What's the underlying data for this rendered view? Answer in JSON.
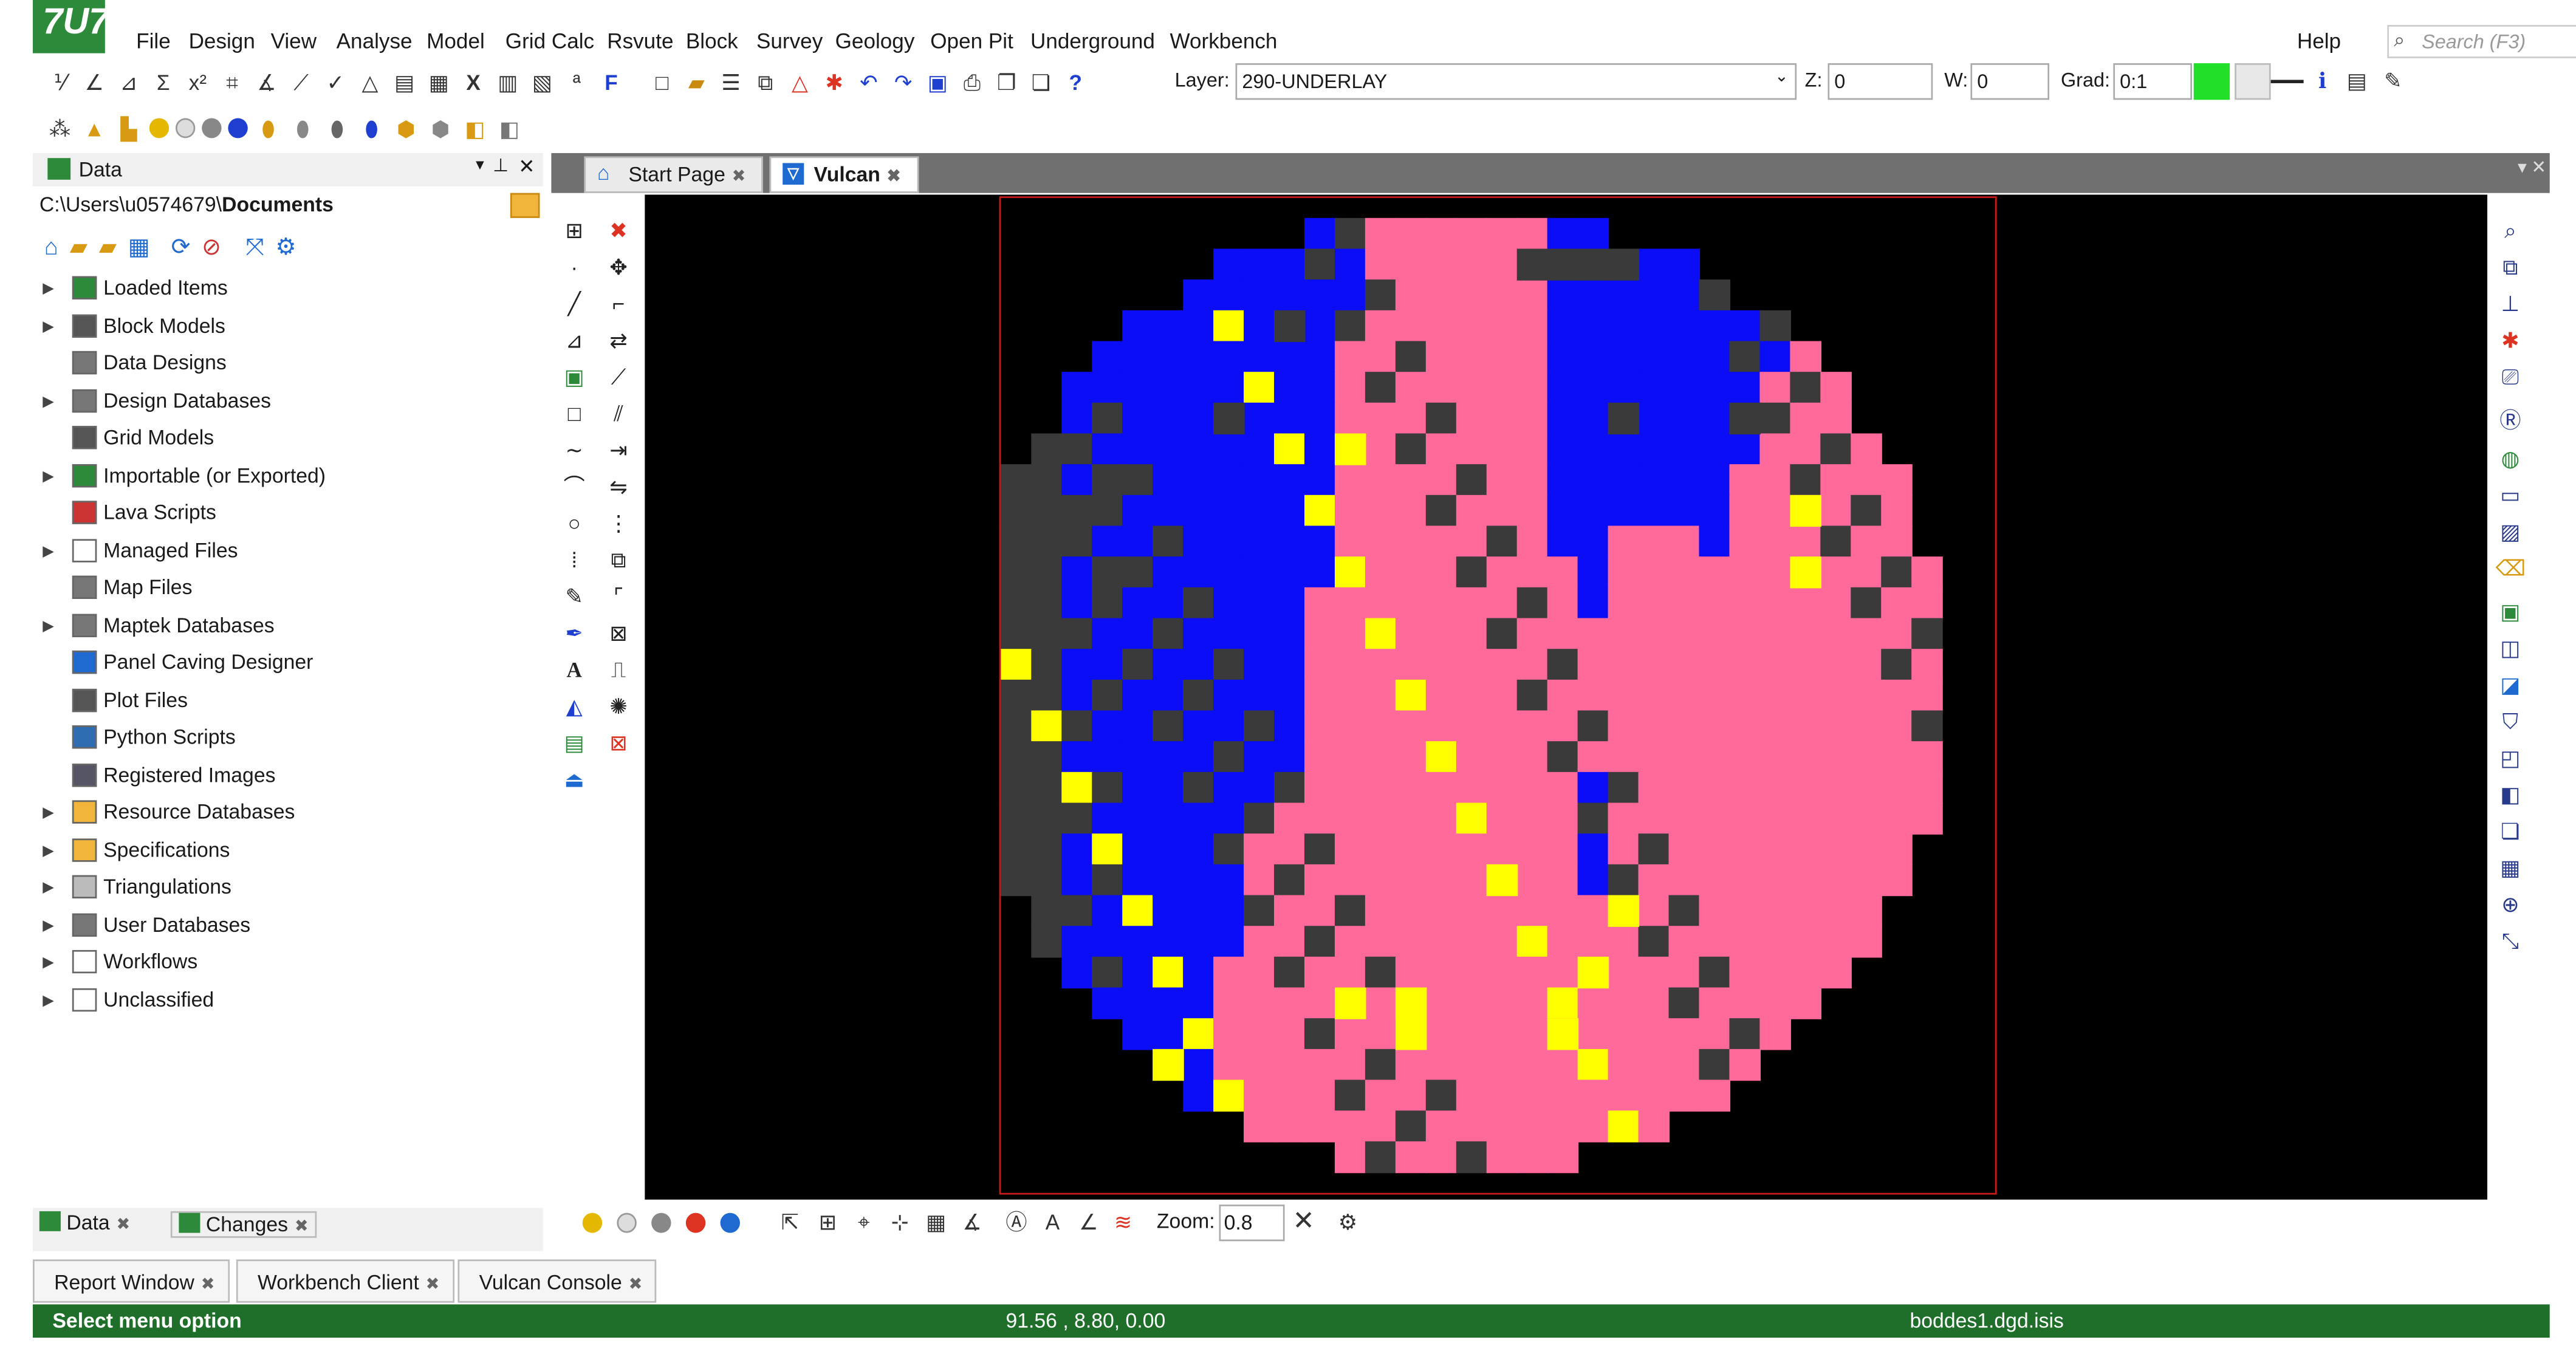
{
  "app": {
    "logo_text": "7U7"
  },
  "menu": {
    "items": [
      "File",
      "Design",
      "View",
      "Analyse",
      "Model",
      "Grid Calc",
      "Rsvute",
      "Block",
      "Survey",
      "Geology",
      "Open Pit",
      "Underground",
      "Workbench"
    ],
    "help": "Help",
    "search_placeholder": "Search (F3)"
  },
  "toolbar": {
    "layer_label": "Layer:",
    "layer_value": "290-UNDERLAY",
    "z_label": "Z:",
    "z_value": "0",
    "w_label": "W:",
    "w_value": "0",
    "grad_label": "Grad:",
    "grad_value": "0:1",
    "color_swatch": "#22e02a"
  },
  "data_panel": {
    "title": "Data",
    "path_prefix": "C:\\Users\\u0574679\\",
    "path_bold": "Documents",
    "items": [
      {
        "label": "Loaded Items",
        "expandable": true,
        "icon": "loaded-items-icon"
      },
      {
        "label": "Block Models",
        "expandable": true,
        "icon": "block-models-icon"
      },
      {
        "label": "Data Designs",
        "expandable": false,
        "icon": "database-icon"
      },
      {
        "label": "Design Databases",
        "expandable": true,
        "icon": "database-icon"
      },
      {
        "label": "Grid Models",
        "expandable": false,
        "icon": "grid-icon"
      },
      {
        "label": "Importable (or Exported)",
        "expandable": true,
        "icon": "import-icon"
      },
      {
        "label": "Lava Scripts",
        "expandable": false,
        "icon": "script-icon"
      },
      {
        "label": "Managed Files",
        "expandable": true,
        "icon": "file-icon"
      },
      {
        "label": "Map Files",
        "expandable": false,
        "icon": "database-icon"
      },
      {
        "label": "Maptek Databases",
        "expandable": true,
        "icon": "database-icon"
      },
      {
        "label": "Panel Caving Designer",
        "expandable": false,
        "icon": "panel-icon"
      },
      {
        "label": "Plot Files",
        "expandable": false,
        "icon": "plot-icon"
      },
      {
        "label": "Python Scripts",
        "expandable": false,
        "icon": "python-icon"
      },
      {
        "label": "Registered Images",
        "expandable": false,
        "icon": "image-icon"
      },
      {
        "label": "Resource Databases",
        "expandable": true,
        "icon": "folder-icon"
      },
      {
        "label": "Specifications",
        "expandable": true,
        "icon": "folder-icon"
      },
      {
        "label": "Triangulations",
        "expandable": true,
        "icon": "triangle-icon"
      },
      {
        "label": "User Databases",
        "expandable": true,
        "icon": "database-icon"
      },
      {
        "label": "Workflows",
        "expandable": true,
        "icon": "workflow-icon"
      },
      {
        "label": "Unclassified",
        "expandable": true,
        "icon": "file-icon"
      }
    ],
    "bottom_tabs": [
      "Data",
      "Changes"
    ]
  },
  "editor_tabs": [
    {
      "label": "Start Page",
      "active": false
    },
    {
      "label": "Vulcan",
      "active": true
    }
  ],
  "viewport": {
    "colors": {
      "blue": "#0a0df5",
      "pink": "#ff6a9b",
      "gray": "#3a3a3a",
      "yellow": "#ffff00",
      "bg": "#000000",
      "frame": "#c81a1a"
    }
  },
  "view_toolbar": {
    "zoom_label": "Zoom:",
    "zoom_value": "0.8"
  },
  "doc_tabs": [
    "Report Window",
    "Workbench Client",
    "Vulcan Console"
  ],
  "status_bar": {
    "message": "Select menu option",
    "coordinates": "91.56 , 8.80, 0.00",
    "file": "boddes1.dgd.isis"
  }
}
